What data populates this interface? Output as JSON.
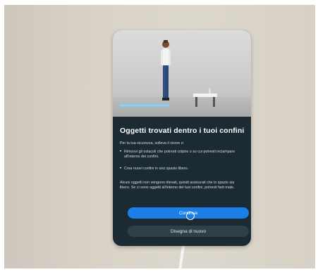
{
  "dialog": {
    "title": "Oggetti trovati dentro i tuoi confini",
    "intro": "Per la tua sicurezza, solleva il visore e:",
    "bullets": [
      "Rimuovi gli ostacoli che potresti colpire o su cui potresti inciampare all'interno dei confini.",
      "Crea nuovi confini in uno spazio libero."
    ],
    "note": "Alcuni oggetti non vengono rilevati, quindi assicurati che lo spazio sia libero. Se ci sono oggetti all'interno dei tuoi confini, potresti farti male.",
    "primary_button": "Continua",
    "secondary_button": "Disegna di nuovo"
  },
  "colors": {
    "panel_background": "#1b2a33",
    "primary_button": "#1b7fe8",
    "secondary_button": "#2f4049",
    "boundary_line": "#7fd7ff"
  },
  "icons": {
    "bullet": "•"
  }
}
